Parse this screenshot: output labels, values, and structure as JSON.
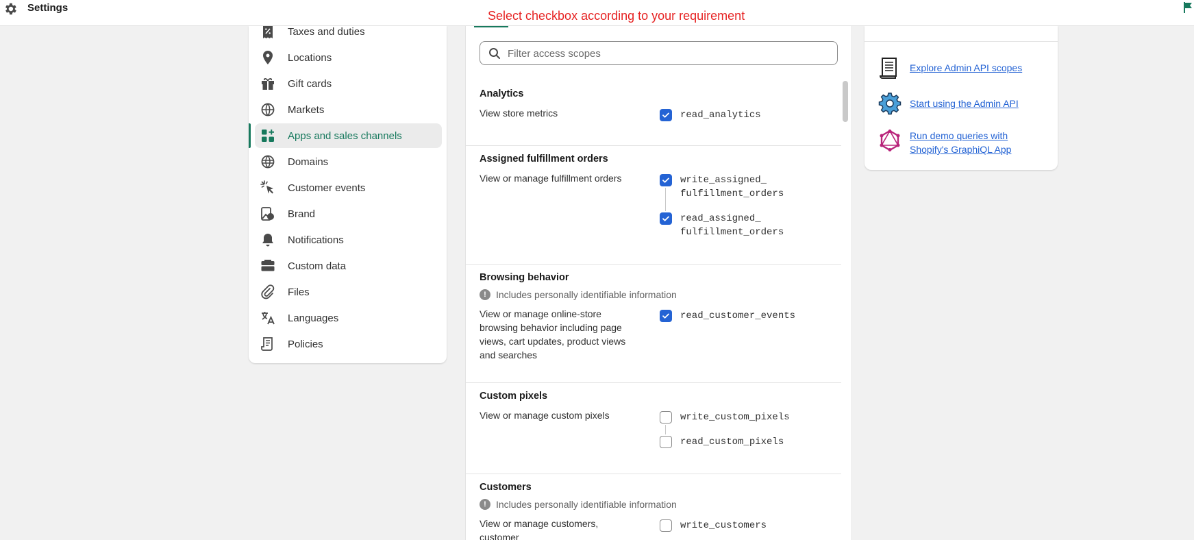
{
  "topbar": {
    "title": "Settings",
    "banner": "Select checkbox according to your requirement"
  },
  "nav": {
    "items": [
      {
        "label": "Taxes and duties",
        "icon": "receipt-percent-icon",
        "active": false
      },
      {
        "label": "Locations",
        "icon": "location-pin-icon",
        "active": false
      },
      {
        "label": "Gift cards",
        "icon": "gift-card-icon",
        "active": false
      },
      {
        "label": "Markets",
        "icon": "globe-markets-icon",
        "active": false
      },
      {
        "label": "Apps and sales channels",
        "icon": "apps-icon",
        "active": true
      },
      {
        "label": "Domains",
        "icon": "globe-icon",
        "active": false
      },
      {
        "label": "Customer events",
        "icon": "cursor-click-icon",
        "active": false
      },
      {
        "label": "Brand",
        "icon": "brand-icon",
        "active": false
      },
      {
        "label": "Notifications",
        "icon": "bell-icon",
        "active": false
      },
      {
        "label": "Custom data",
        "icon": "database-icon",
        "active": false
      },
      {
        "label": "Files",
        "icon": "paperclip-icon",
        "active": false
      },
      {
        "label": "Languages",
        "icon": "translate-icon",
        "active": false
      },
      {
        "label": "Policies",
        "icon": "policy-icon",
        "active": false
      }
    ]
  },
  "filter": {
    "placeholder": "Filter access scopes"
  },
  "pii_note": "Includes personally identifiable information",
  "sections": [
    {
      "title": "Analytics",
      "description": "View store metrics",
      "scopes": [
        {
          "name": "read_analytics",
          "checked": true
        }
      ]
    },
    {
      "title": "Assigned fulfillment orders",
      "description": "View or manage fulfillment orders",
      "scopes": [
        {
          "name": "write_assigned_\nfulfillment_orders",
          "checked": true
        },
        {
          "name": "read_assigned_\nfulfillment_orders",
          "checked": true
        }
      ]
    },
    {
      "title": "Browsing behavior",
      "description": "View or manage online-store browsing behavior including page views, cart updates, product views and searches",
      "scopes": [
        {
          "name": "read_customer_events",
          "checked": true
        }
      ]
    },
    {
      "title": "Custom pixels",
      "description": "View or manage custom pixels",
      "scopes": [
        {
          "name": "write_custom_pixels",
          "checked": false
        },
        {
          "name": "read_custom_pixels",
          "checked": false
        }
      ]
    },
    {
      "title": "Customers",
      "description": "View or manage customers, customer",
      "scopes": [
        {
          "name": "write_customers",
          "checked": false
        }
      ]
    }
  ],
  "resources": {
    "links": [
      {
        "label": "Explore Admin API scopes",
        "icon": "document-scroll-icon"
      },
      {
        "label": "Start using the Admin API",
        "icon": "gear-cog-icon"
      },
      {
        "label": "Run demo queries with Shopify's GraphiQL App",
        "icon": "graphql-icon"
      }
    ]
  },
  "colors": {
    "accent_green": "#17795d",
    "checkbox_blue": "#2463d4",
    "banner_red": "#e62222",
    "link_blue": "#2463d4"
  }
}
